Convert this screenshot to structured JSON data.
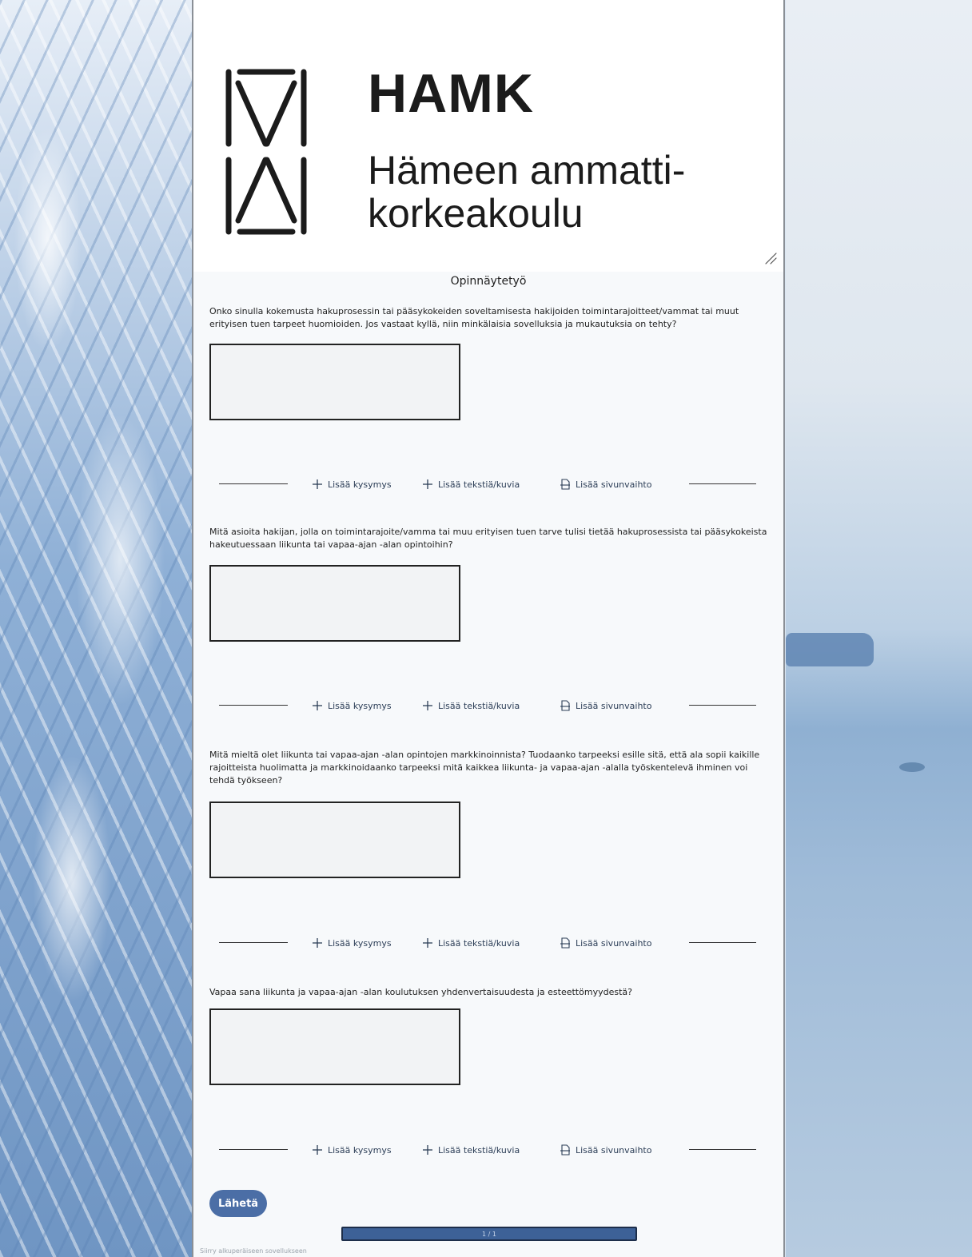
{
  "brand": {
    "name": "HAMK",
    "subtitle_line1": "Hämeen ammatti-",
    "subtitle_line2": "korkeakoulu"
  },
  "form": {
    "title": "Opinnäytetyö",
    "questions": [
      {
        "text": "Onko sinulla kokemusta hakuprosessin tai pääsykokeiden soveltamisesta hakijoiden toimintarajoitteet/vammat tai muut erityisen tuen tarpeet huomioiden. Jos vastaat kyllä, niin minkälaisia sovelluksia ja mukautuksia on tehty?"
      },
      {
        "text": "Mitä asioita hakijan, jolla on toimintarajoite/vamma tai muu erityisen tuen tarve tulisi tietää hakuprosessista tai pääsykokeista hakeutuessaan liikunta tai vapaa-ajan -alan opintoihin?"
      },
      {
        "text": "Mitä mieltä olet liikunta tai vapaa-ajan -alan opintojen markkinoinnista? Tuodaanko tarpeeksi esille sitä, että ala sopii kaikille rajoitteista huolimatta ja markkinoidaanko tarpeeksi mitä kaikkea liikunta- ja vapaa-ajan -alalla työskentelevä ihminen voi tehdä työkseen?"
      },
      {
        "text": "Vapaa sana liikunta ja vapaa-ajan -alan koulutuksen yhdenvertaisuudesta ja esteettömyydestä?"
      }
    ],
    "actions": {
      "add_question": "Lisää kysymys",
      "add_text_image": "Lisää tekstiä/kuvia",
      "add_page_break": "Lisää sivunvaihto"
    },
    "submit_label": "Lähetä",
    "pager_text": "1 / 1",
    "footer_note": "Siirry alkuperäiseen sovellukseen"
  },
  "icons": [
    "plus-icon",
    "page-break-icon",
    "resize-grip-icon",
    "hamk-logo-mark"
  ],
  "colors": {
    "accent": "#4b6ea6",
    "pager": "#3d6197",
    "panel": "#f7f9fb"
  }
}
